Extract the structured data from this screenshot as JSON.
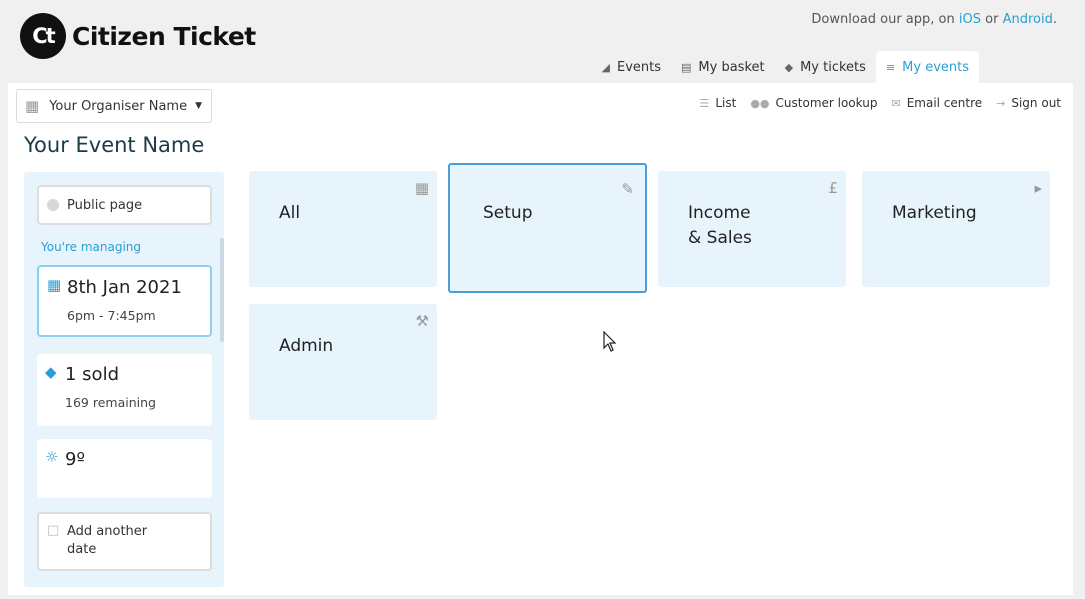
{
  "brand": {
    "mark": "Ct",
    "name": "Citizen Ticket"
  },
  "app_promo": {
    "text": "Download our app, on",
    "ios": "iOS",
    "or": "or",
    "android": "Android",
    "dot": "."
  },
  "main_tabs": [
    {
      "label": "Events",
      "icon": "tag-icon"
    },
    {
      "label": "My basket",
      "icon": "basket-icon"
    },
    {
      "label": "My tickets",
      "icon": "ticket-icon"
    },
    {
      "label": "My events",
      "icon": "sliders-icon",
      "active": true
    }
  ],
  "organiser": {
    "label": "Your Organiser Name"
  },
  "util_links": [
    {
      "label": "List",
      "icon": "list-icon"
    },
    {
      "label": "Customer lookup",
      "icon": "users-icon"
    },
    {
      "label": "Email centre",
      "icon": "envelope-icon"
    },
    {
      "label": "Sign out",
      "icon": "sign-out-icon"
    }
  ],
  "event_title": "Your Event Name",
  "sidebar": {
    "public_page": "Public page",
    "managing": "You're managing",
    "date": {
      "main": "8th Jan 2021",
      "time": "6pm - 7:45pm"
    },
    "sold": {
      "main": "1 sold",
      "remaining": "169 remaining"
    },
    "weather": {
      "main": "9º"
    },
    "add_date": "Add another date"
  },
  "tiles": {
    "all": {
      "label": "All",
      "icon": "grid-icon"
    },
    "setup": {
      "label": "Setup",
      "icon": "wrench-icon"
    },
    "income": {
      "label": "Income\n& Sales",
      "icon": "pound-icon"
    },
    "marketing": {
      "label": "Marketing",
      "icon": "bullhorn-icon"
    },
    "admin": {
      "label": "Admin",
      "icon": "gavel-icon"
    }
  },
  "colors": {
    "accent": "#2a9fd6",
    "tile_bg": "#e8f4fc",
    "selected_border": "#4a9fd8"
  }
}
